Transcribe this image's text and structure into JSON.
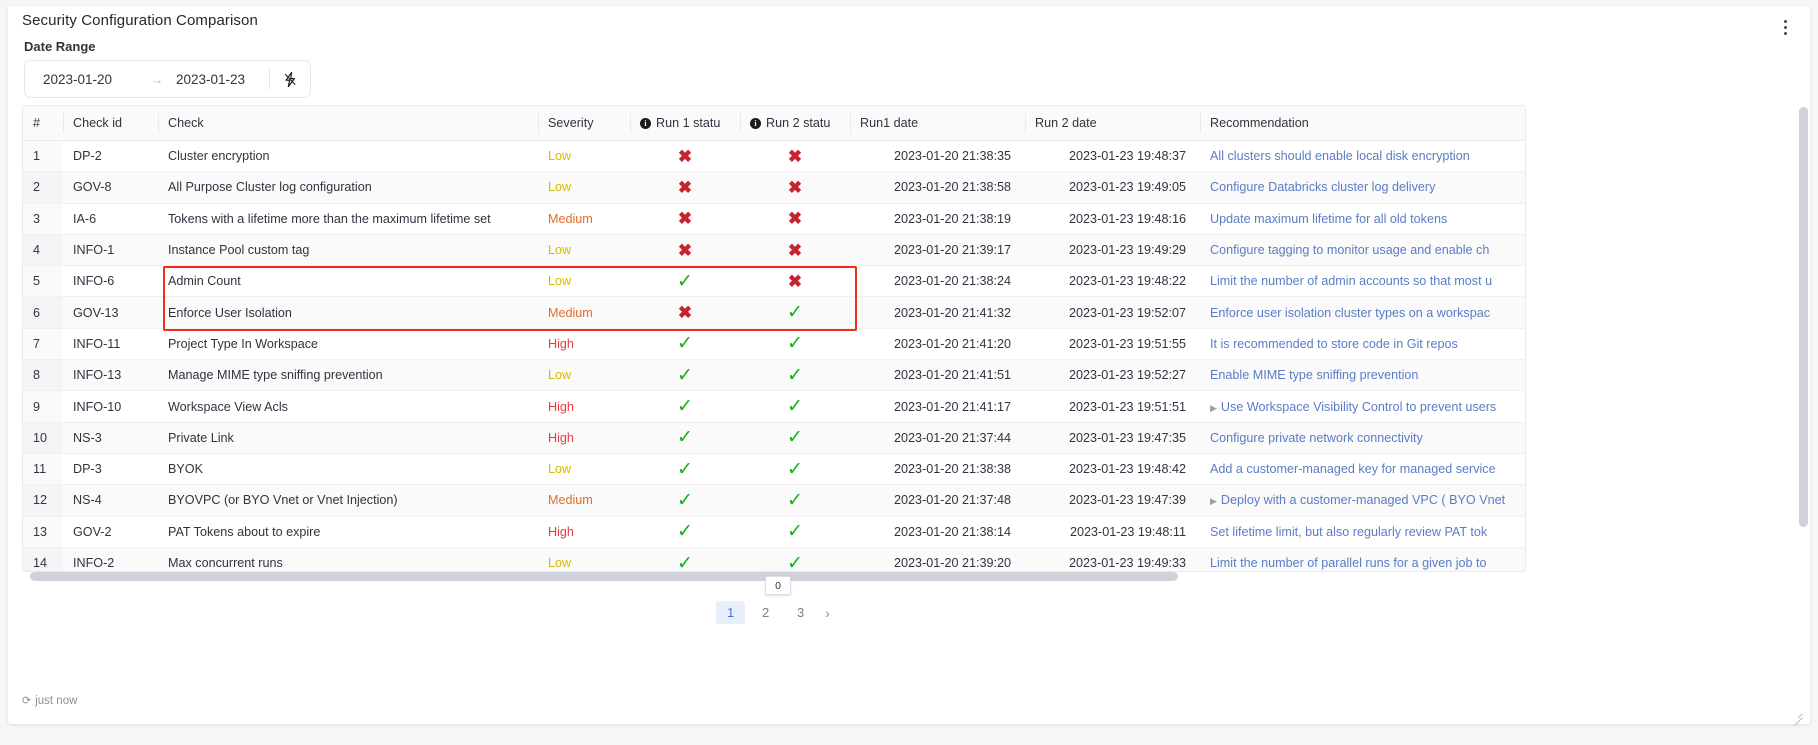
{
  "header": {
    "title": "Security Configuration Comparison",
    "menu_icon": "kebab-menu-icon"
  },
  "date_range": {
    "label": "Date Range",
    "start": "2023-01-20",
    "arrow": "→",
    "end": "2023-01-23",
    "action_icon": "lightning-bolt-icon"
  },
  "table": {
    "columns": [
      {
        "key": "idx",
        "label": "#"
      },
      {
        "key": "check_id",
        "label": "Check id"
      },
      {
        "key": "check",
        "label": "Check"
      },
      {
        "key": "severity",
        "label": "Severity"
      },
      {
        "key": "run1_status",
        "label": "Run 1 statu",
        "info_icon": "info-icon"
      },
      {
        "key": "run2_status",
        "label": "Run 2 statu",
        "info_icon": "info-icon"
      },
      {
        "key": "run1_date",
        "label": "Run1 date"
      },
      {
        "key": "run2_date",
        "label": "Run 2 date"
      },
      {
        "key": "recommendation",
        "label": "Recommendation"
      }
    ],
    "rows": [
      {
        "idx": "1",
        "check_id": "DP-2",
        "check": "Cluster encryption",
        "severity": "Low",
        "run1_status": "fail",
        "run2_status": "fail",
        "run1_date": "2023-01-20 21:38:35",
        "run2_date": "2023-01-23 19:48:37",
        "recommendation": "All clusters should enable local disk encryption",
        "rec_marker": false
      },
      {
        "idx": "2",
        "check_id": "GOV-8",
        "check": "All Purpose Cluster log configuration",
        "severity": "Low",
        "run1_status": "fail",
        "run2_status": "fail",
        "run1_date": "2023-01-20 21:38:58",
        "run2_date": "2023-01-23 19:49:05",
        "recommendation": "Configure Databricks cluster log delivery",
        "rec_marker": false
      },
      {
        "idx": "3",
        "check_id": "IA-6",
        "check": "Tokens with a lifetime more than the maximum lifetime set",
        "severity": "Medium",
        "run1_status": "fail",
        "run2_status": "fail",
        "run1_date": "2023-01-20 21:38:19",
        "run2_date": "2023-01-23 19:48:16",
        "recommendation": "Update maximum lifetime for all old tokens",
        "rec_marker": false
      },
      {
        "idx": "4",
        "check_id": "INFO-1",
        "check": "Instance Pool custom tag",
        "severity": "Low",
        "run1_status": "fail",
        "run2_status": "fail",
        "run1_date": "2023-01-20 21:39:17",
        "run2_date": "2023-01-23 19:49:29",
        "recommendation": "Configure tagging to monitor usage and enable ch",
        "rec_marker": false
      },
      {
        "idx": "5",
        "check_id": "INFO-6",
        "check": "Admin Count",
        "severity": "Low",
        "run1_status": "pass",
        "run2_status": "fail",
        "run1_date": "2023-01-20 21:38:24",
        "run2_date": "2023-01-23 19:48:22",
        "recommendation": "Limit the number of admin accounts so that most u",
        "rec_marker": false
      },
      {
        "idx": "6",
        "check_id": "GOV-13",
        "check": "Enforce User Isolation",
        "severity": "Medium",
        "run1_status": "fail",
        "run2_status": "pass",
        "run1_date": "2023-01-20 21:41:32",
        "run2_date": "2023-01-23 19:52:07",
        "recommendation": "Enforce user isolation cluster types on a workspac",
        "rec_marker": false
      },
      {
        "idx": "7",
        "check_id": "INFO-11",
        "check": "Project Type In Workspace",
        "severity": "High",
        "run1_status": "pass",
        "run2_status": "pass",
        "run1_date": "2023-01-20 21:41:20",
        "run2_date": "2023-01-23 19:51:55",
        "recommendation": "It is recommended to store code in Git repos",
        "rec_marker": false
      },
      {
        "idx": "8",
        "check_id": "INFO-13",
        "check": "Manage MIME type sniffing prevention",
        "severity": "Low",
        "run1_status": "pass",
        "run2_status": "pass",
        "run1_date": "2023-01-20 21:41:51",
        "run2_date": "2023-01-23 19:52:27",
        "recommendation": "Enable MIME type sniffing prevention",
        "rec_marker": false
      },
      {
        "idx": "9",
        "check_id": "INFO-10",
        "check": "Workspace View Acls",
        "severity": "High",
        "run1_status": "pass",
        "run2_status": "pass",
        "run1_date": "2023-01-20 21:41:17",
        "run2_date": "2023-01-23 19:51:51",
        "recommendation": "Use Workspace Visibility Control to prevent users",
        "rec_marker": true
      },
      {
        "idx": "10",
        "check_id": "NS-3",
        "check": "Private Link",
        "severity": "High",
        "run1_status": "pass",
        "run2_status": "pass",
        "run1_date": "2023-01-20 21:37:44",
        "run2_date": "2023-01-23 19:47:35",
        "recommendation": "Configure private network connectivity",
        "rec_marker": false
      },
      {
        "idx": "11",
        "check_id": "DP-3",
        "check": "BYOK",
        "severity": "Low",
        "run1_status": "pass",
        "run2_status": "pass",
        "run1_date": "2023-01-20 21:38:38",
        "run2_date": "2023-01-23 19:48:42",
        "recommendation": "Add a customer-managed key for managed service",
        "rec_marker": false
      },
      {
        "idx": "12",
        "check_id": "NS-4",
        "check": "BYOVPC (or BYO Vnet or Vnet Injection)",
        "severity": "Medium",
        "run1_status": "pass",
        "run2_status": "pass",
        "run1_date": "2023-01-20 21:37:48",
        "run2_date": "2023-01-23 19:47:39",
        "recommendation": "Deploy with a customer-managed VPC ( BYO Vnet",
        "rec_marker": true
      },
      {
        "idx": "13",
        "check_id": "GOV-2",
        "check": "PAT Tokens about to expire",
        "severity": "High",
        "run1_status": "pass",
        "run2_status": "pass",
        "run1_date": "2023-01-20 21:38:14",
        "run2_date": "2023-01-23 19:48:11",
        "recommendation": "Set lifetime limit, but also regularly review PAT tok",
        "rec_marker": false
      },
      {
        "idx": "14",
        "check_id": "INFO-2",
        "check": "Max concurrent runs",
        "severity": "Low",
        "run1_status": "pass",
        "run2_status": "pass",
        "run1_date": "2023-01-20 21:39:20",
        "run2_date": "2023-01-23 19:49:33",
        "recommendation": "Limit the number of parallel runs for a given job to",
        "rec_marker": false
      }
    ]
  },
  "highlight": {
    "rows": [
      "5",
      "6"
    ],
    "color": "#f22d18"
  },
  "scroll": {
    "horizontal_tooltip": "0"
  },
  "pagination": {
    "pages": [
      "1",
      "2",
      "3"
    ],
    "current": "1",
    "next_label": "›"
  },
  "footer": {
    "refresh_icon": "refresh-icon",
    "status": "just now"
  },
  "status_glyphs": {
    "pass": "✓",
    "fail": "✖"
  }
}
